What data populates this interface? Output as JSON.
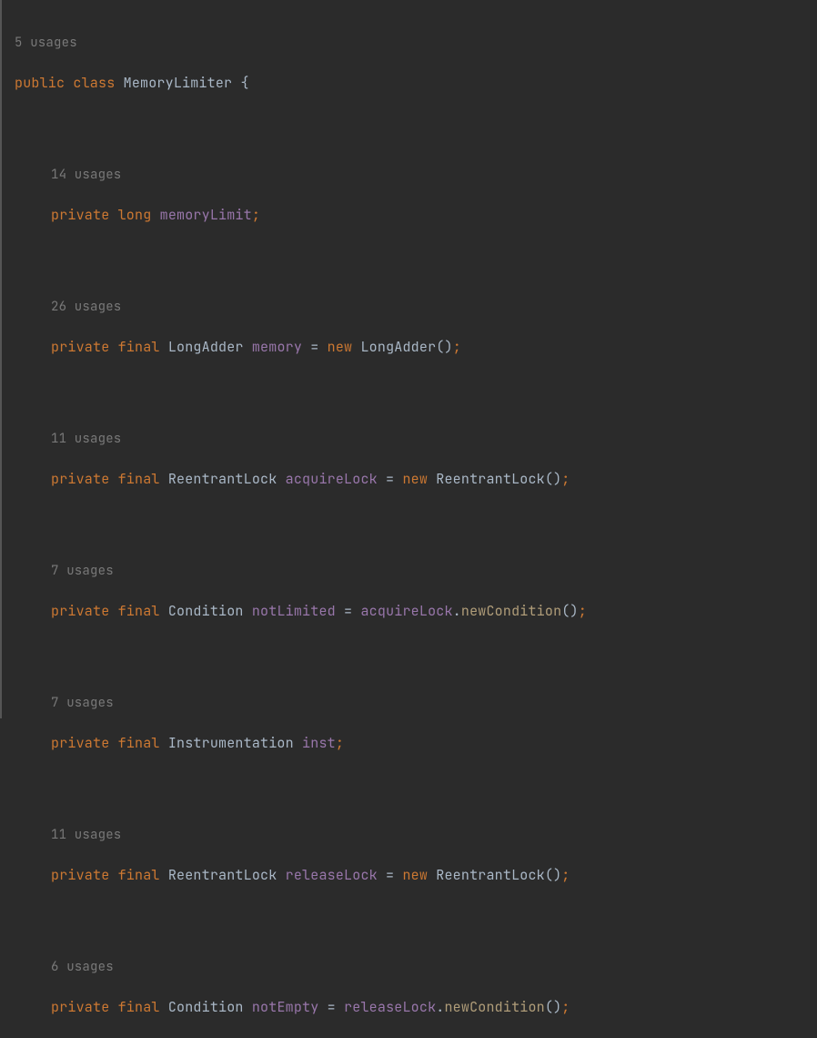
{
  "class": {
    "usages": "5 usages",
    "decl_public": "public",
    "decl_class": "class",
    "name": "MemoryLimiter",
    "brace": "{"
  },
  "fields": [
    {
      "usages": "14 usages",
      "kw1": "private",
      "kw2": "long",
      "type": "",
      "name": "memoryLimit",
      "rest": ";"
    },
    {
      "usages": "26 usages",
      "kw1": "private",
      "kw2": "final",
      "type": "LongAdder",
      "name": "memory",
      "assign": " = ",
      "kw3": "new",
      "ctor": "LongAdder",
      "rest": "();"
    },
    {
      "usages": "11 usages",
      "kw1": "private",
      "kw2": "final",
      "type": "ReentrantLock",
      "name": "acquireLock",
      "assign": " = ",
      "kw3": "new",
      "ctor": "ReentrantLock",
      "rest": "();"
    },
    {
      "usages": "7 usages",
      "kw1": "private",
      "kw2": "final",
      "type": "Condition",
      "name": "notLimited",
      "assign": " = ",
      "ref": "acquireLock",
      "dot": ".",
      "method": "newCondition",
      "rest": "();"
    },
    {
      "usages": "7 usages",
      "kw1": "private",
      "kw2": "final",
      "type": "Instrumentation",
      "name": "inst",
      "rest": ";"
    },
    {
      "usages": "11 usages",
      "kw1": "private",
      "kw2": "final",
      "type": "ReentrantLock",
      "name": "releaseLock",
      "assign": " = ",
      "kw3": "new",
      "ctor": "ReentrantLock",
      "rest": "();"
    },
    {
      "usages": "6 usages",
      "kw1": "private",
      "kw2": "final",
      "type": "Condition",
      "name": "notEmpty",
      "assign": " = ",
      "ref": "releaseLock",
      "dot": ".",
      "method": "newCondition",
      "rest": "();"
    }
  ]
}
